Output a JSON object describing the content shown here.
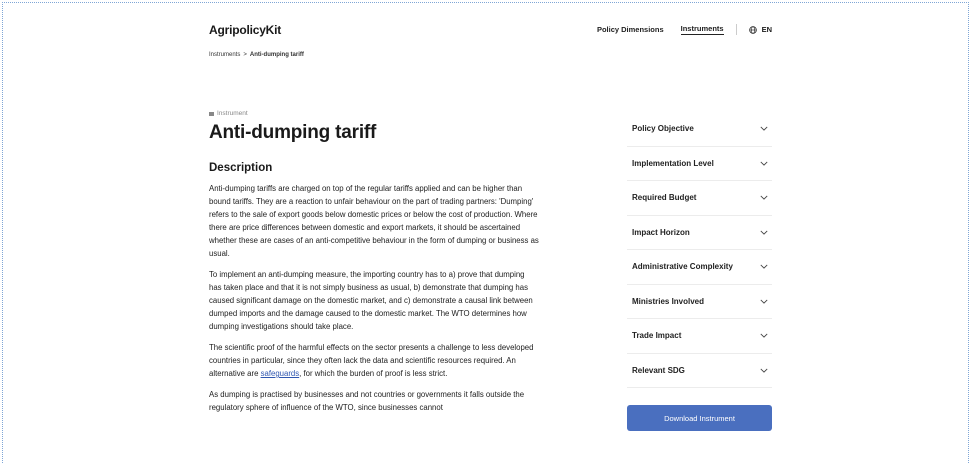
{
  "header": {
    "brand": "AgripolicyKit",
    "nav": [
      {
        "label": "Policy Dimensions",
        "active": false
      },
      {
        "label": "Instruments",
        "active": true
      }
    ],
    "language": "EN"
  },
  "breadcrumb": {
    "parent": "Instruments",
    "separator": ">",
    "current": "Anti-dumping tariff"
  },
  "main": {
    "eyebrow": "Instrument",
    "title": "Anti-dumping tariff",
    "section_title": "Description",
    "paragraphs": [
      "Anti-dumping tariffs are charged on top of the regular tariffs applied and can be higher than bound tariffs. They are a reaction to unfair behaviour on the part of trading partners: 'Dumping' refers to the sale of export goods below domestic prices or below the cost of production. Where there are price differences between domestic and export markets, it should be ascertained whether these are cases of an anti-competitive behaviour in the form of dumping or business as usual.",
      "To implement an anti-dumping measure, the importing country has to a) prove that dumping has taken place and that it is not simply business as usual, b) demonstrate that dumping has caused significant damage on the domestic market, and c) demonstrate a causal link between dumped imports and the damage caused to the domestic market. The WTO determines how dumping investigations should take place.",
      {
        "before": "The scientific proof of the harmful effects on the sector presents a challenge to less developed countries in particular, since they often lack the data and scientific resources required. An alternative are ",
        "link": "safeguards",
        "after": ", for which the burden of proof is less strict."
      },
      "As dumping is practised by businesses and not countries or governments it falls outside the regulatory sphere of influence of the WTO, since businesses cannot"
    ]
  },
  "filters": [
    "Policy Objective",
    "Implementation Level",
    "Required Budget",
    "Impact Horizon",
    "Administrative Complexity",
    "Ministries Involved",
    "Trade Impact",
    "Relevant SDG"
  ],
  "download_label": "Download Instrument",
  "colors": {
    "accent": "#4a6fbf",
    "link": "#2f56b0",
    "frame": "#7fa6d6"
  },
  "icons": {
    "language": "globe-icon",
    "filter_toggle": "chevron-down-icon",
    "eyebrow": "instrument-icon"
  }
}
